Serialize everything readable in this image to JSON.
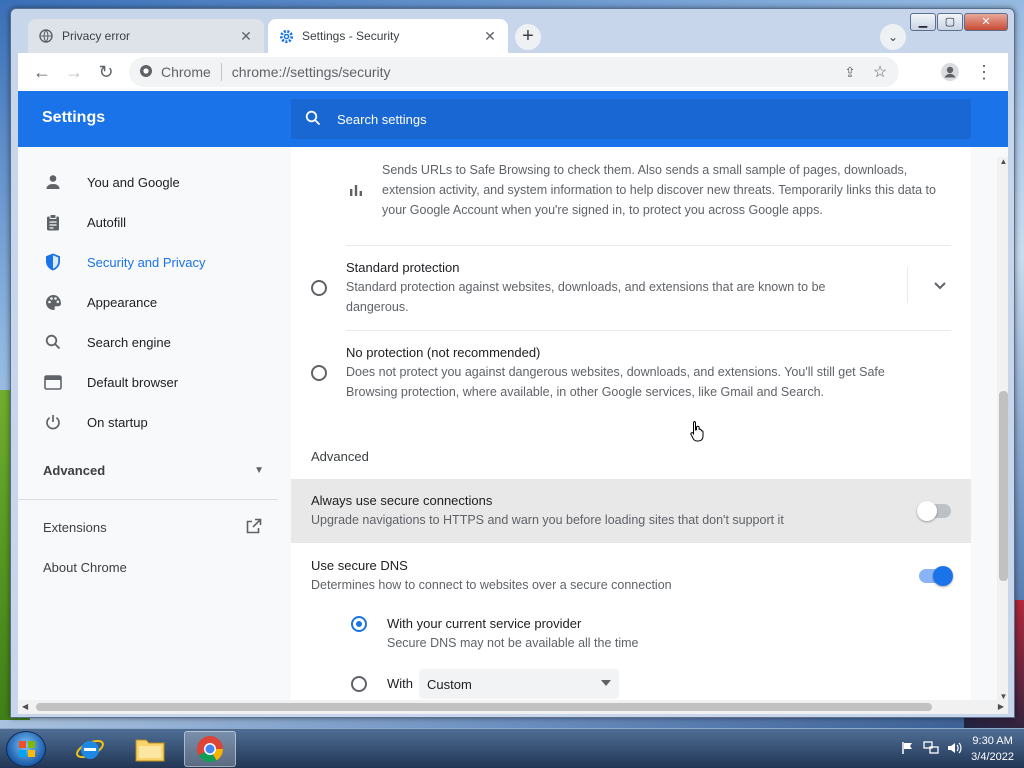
{
  "tabs": [
    {
      "label": "Privacy error",
      "icon": "globe-icon",
      "active": false
    },
    {
      "label": "Settings - Security",
      "icon": "gear-icon",
      "active": true
    }
  ],
  "omnibox": {
    "site_chip": "Chrome",
    "url": "chrome://settings/security"
  },
  "header": {
    "title": "Settings",
    "search_placeholder": "Search settings"
  },
  "sidebar": {
    "items": [
      {
        "label": "You and Google",
        "icon": "person-icon"
      },
      {
        "label": "Autofill",
        "icon": "clipboard-icon"
      },
      {
        "label": "Security and Privacy",
        "icon": "shield-icon",
        "selected": true
      },
      {
        "label": "Appearance",
        "icon": "palette-icon"
      },
      {
        "label": "Search engine",
        "icon": "search-icon"
      },
      {
        "label": "Default browser",
        "icon": "browser-icon"
      },
      {
        "label": "On startup",
        "icon": "power-icon"
      }
    ],
    "advanced": "Advanced",
    "extensions": "Extensions",
    "about": "About Chrome"
  },
  "main": {
    "enhanced_text": "Sends URLs to Safe Browsing to check them. Also sends a small sample of pages, downloads, extension activity, and system information to help discover new threats. Temporarily links this data to your Google Account when you're signed in, to protect you across Google apps.",
    "standard": {
      "title": "Standard protection",
      "description": "Standard protection against websites, downloads, and extensions that are known to be dangerous."
    },
    "none": {
      "title": "No protection (not recommended)",
      "description": "Does not protect you against dangerous websites, downloads, and extensions. You'll still get Safe Browsing protection, where available, in other Google services, like Gmail and Search."
    },
    "advanced_heading": "Advanced",
    "secure_connections": {
      "title": "Always use secure connections",
      "description": "Upgrade navigations to HTTPS and warn you before loading sites that don't support it",
      "enabled": false
    },
    "secure_dns": {
      "title": "Use secure DNS",
      "description": "Determines how to connect to websites over a secure connection",
      "enabled": true
    },
    "dns_current": {
      "title": "With your current service provider",
      "description": "Secure DNS may not be available all the time",
      "selected": true
    },
    "dns_custom": {
      "label": "With",
      "select_value": "Custom",
      "selected": false
    }
  },
  "taskbar": {
    "time": "9:30 AM",
    "date": "3/4/2022"
  },
  "colors": {
    "accent": "#1a73e8",
    "header": "#1a73e8"
  }
}
